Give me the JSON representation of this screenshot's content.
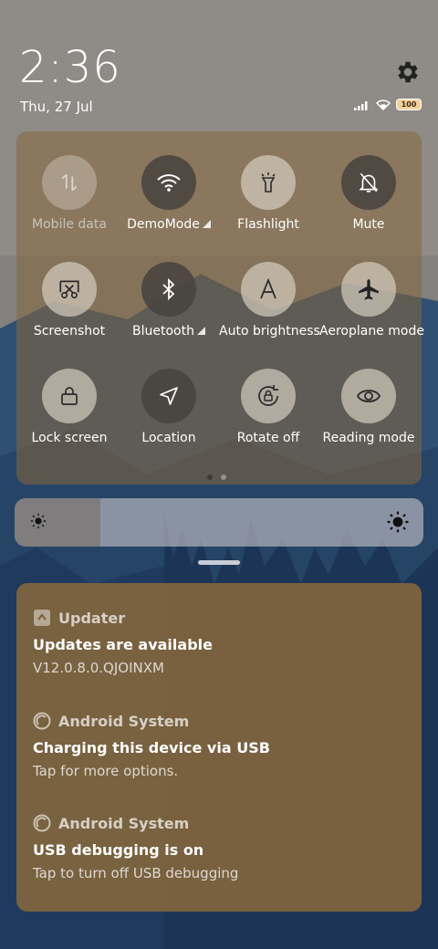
{
  "status": {
    "time": "2:36",
    "date": "Thu, 27 Jul",
    "battery": "100"
  },
  "quick_settings": [
    {
      "label": "Mobile data",
      "state": "disabled",
      "icon": "mobile-data-icon"
    },
    {
      "label": "DemoMode",
      "state": "on",
      "icon": "wifi-icon",
      "has_arrow": true
    },
    {
      "label": "Flashlight",
      "state": "off",
      "icon": "flashlight-icon"
    },
    {
      "label": "Mute",
      "state": "on",
      "icon": "bell-off-icon"
    },
    {
      "label": "Screenshot",
      "state": "off",
      "icon": "screenshot-icon"
    },
    {
      "label": "Bluetooth",
      "state": "on",
      "icon": "bluetooth-icon",
      "has_arrow": true
    },
    {
      "label": "Auto brightness",
      "state": "off",
      "icon": "auto-brightness-icon"
    },
    {
      "label": "Aeroplane mode",
      "state": "off",
      "icon": "airplane-icon"
    },
    {
      "label": "Lock screen",
      "state": "off",
      "icon": "lock-icon"
    },
    {
      "label": "Location",
      "state": "on",
      "icon": "location-icon"
    },
    {
      "label": "Rotate off",
      "state": "off",
      "icon": "rotate-lock-icon"
    },
    {
      "label": "Reading mode",
      "state": "off",
      "icon": "eye-icon"
    }
  ],
  "brightness_level": 0.21,
  "notifications": [
    {
      "app": "Updater",
      "title": "Updates are available",
      "body": "V12.0.8.0.QJOINXM"
    },
    {
      "app": "Android System",
      "title": "Charging this device via USB",
      "body": "Tap for more options."
    },
    {
      "app": "Android System",
      "title": "USB debugging is on",
      "body": "Tap to turn off USB debugging"
    }
  ],
  "colors": {
    "panel": "#86683c",
    "tile_on": "#46423e",
    "tile_off": "#dcd4c8"
  }
}
